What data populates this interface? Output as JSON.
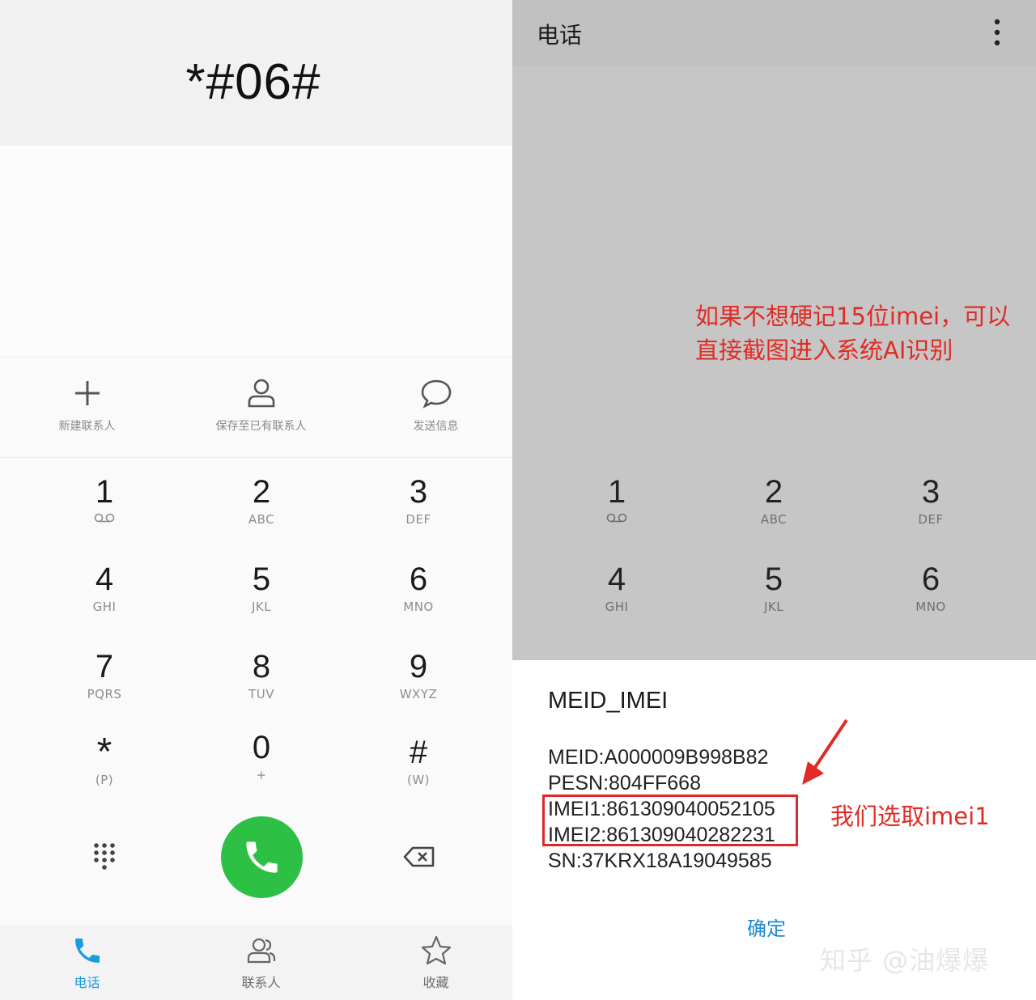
{
  "left": {
    "dialed_number": "*#06#",
    "actions": [
      {
        "label": "新建联系人",
        "icon": "plus-icon"
      },
      {
        "label": "保存至已有联系人",
        "icon": "person-icon"
      },
      {
        "label": "发送信息",
        "icon": "chat-bubble-icon"
      }
    ],
    "keys": [
      {
        "digit": "1",
        "sub": ""
      },
      {
        "digit": "2",
        "sub": "ABC"
      },
      {
        "digit": "3",
        "sub": "DEF"
      },
      {
        "digit": "4",
        "sub": "GHI"
      },
      {
        "digit": "5",
        "sub": "JKL"
      },
      {
        "digit": "6",
        "sub": "MNO"
      },
      {
        "digit": "7",
        "sub": "PQRS"
      },
      {
        "digit": "8",
        "sub": "TUV"
      },
      {
        "digit": "9",
        "sub": "WXYZ"
      },
      {
        "digit": "*",
        "sub": "(P)"
      },
      {
        "digit": "0",
        "sub": "+"
      },
      {
        "digit": "#",
        "sub": "(W)"
      }
    ],
    "nav": [
      {
        "label": "电话",
        "icon": "phone-icon"
      },
      {
        "label": "联系人",
        "icon": "contacts-icon"
      },
      {
        "label": "收藏",
        "icon": "star-icon"
      }
    ],
    "colors": {
      "call_green": "#2dc045",
      "active_blue": "#1a9be0"
    }
  },
  "right": {
    "app_title": "电话",
    "annotation_line1": "如果不想硬记15位imei，可以",
    "annotation_line2": "直接截图进入系统AI识别",
    "keys": [
      {
        "digit": "1",
        "sub": ""
      },
      {
        "digit": "2",
        "sub": "ABC"
      },
      {
        "digit": "3",
        "sub": "DEF"
      },
      {
        "digit": "4",
        "sub": "GHI"
      },
      {
        "digit": "5",
        "sub": "JKL"
      },
      {
        "digit": "6",
        "sub": "MNO"
      }
    ],
    "dialog": {
      "title": "MEID_IMEI",
      "meid": "MEID:A000009B998B82",
      "pesn": "PESN:804FF668",
      "imei1": "IMEI1:861309040052105",
      "imei2": "IMEI2:861309040282231",
      "sn": "SN:37KRX18A19049585",
      "confirm": "确定"
    },
    "annotation_pick": "我们选取imei1",
    "watermark": "知乎 @油爆爆",
    "colors": {
      "annotation_red": "#e12b24",
      "confirm_blue": "#1a8bd1"
    }
  }
}
